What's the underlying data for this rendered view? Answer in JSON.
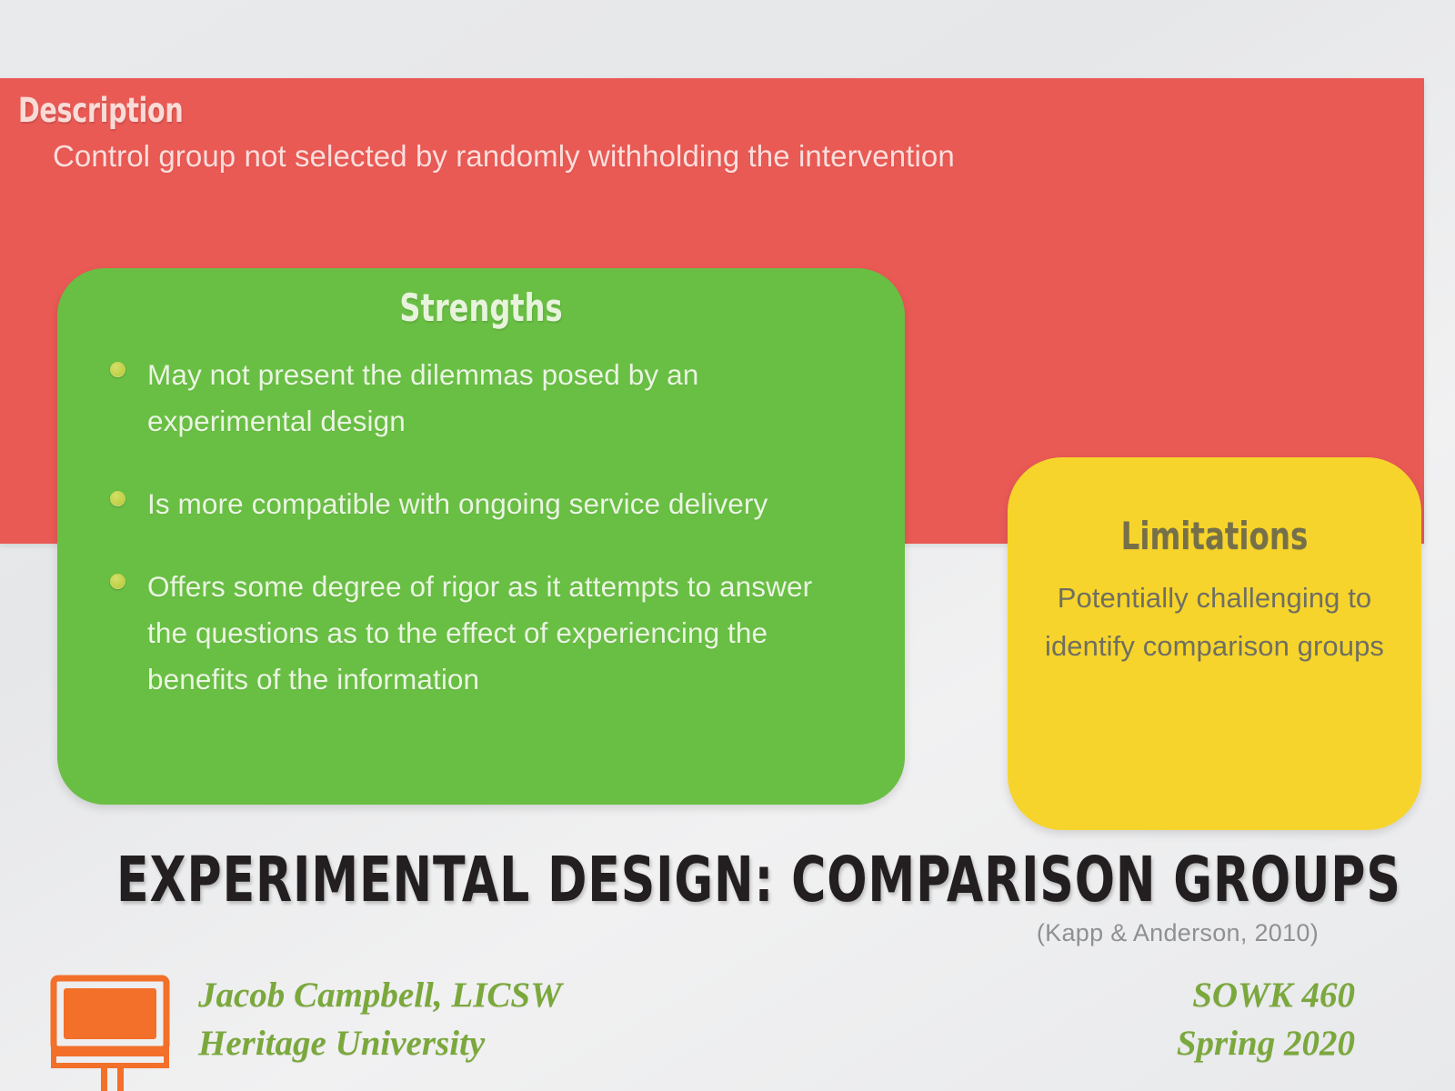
{
  "slide": {
    "title": "EXPERIMENTAL DESIGN: COMPARISON GROUPS",
    "citation": "(Kapp & Anderson, 2010)"
  },
  "description": {
    "heading": "Description",
    "body": "Control group not selected by randomly withholding the intervention",
    "color": "#ea5a55"
  },
  "strengths": {
    "heading": "Strengths",
    "color": "#69bf43",
    "bullet_color": "#c3d14a",
    "items": [
      "May not present the dilemmas posed by an experimental design",
      "Is more compatible with ongoing service delivery",
      "Offers some degree of rigor as it attempts to answer the questions as to the effect of experiencing the benefits of the information"
    ]
  },
  "limitations": {
    "heading": "Limitations",
    "body": "Potentially challenging to identify comparison groups",
    "color": "#f7d42b",
    "text_color": "#6f6f62"
  },
  "footer": {
    "logo_name": "billboard-sign-icon",
    "logo_color": "#f2702a",
    "presenter_name": "Jacob Campbell, LICSW",
    "institution": "Heritage University",
    "course": "SOWK 460",
    "term": "Spring 2020",
    "accent_color": "#7ba83c"
  }
}
